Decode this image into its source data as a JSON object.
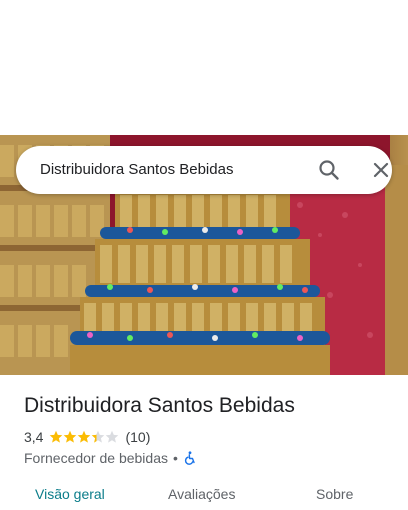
{
  "search": {
    "query": "Distribuidora Santos Bebidas"
  },
  "place": {
    "name": "Distribuidora Santos Bebidas",
    "rating": "3,4",
    "stars_filled": 3.4,
    "review_count": "(10)",
    "category": "Fornecedor de bebidas",
    "separator": "•"
  },
  "tabs": [
    {
      "label": "Visão geral",
      "active": true
    },
    {
      "label": "Avaliações",
      "active": false
    },
    {
      "label": "Sobre",
      "active": false
    }
  ],
  "colors": {
    "accent": "#0b7d8a",
    "star": "#fbbc04",
    "star_empty": "#dadce0",
    "accessibility": "#1a73e8"
  },
  "icons": {
    "search": "search-icon",
    "close": "close-icon",
    "accessibility": "wheelchair-icon"
  }
}
